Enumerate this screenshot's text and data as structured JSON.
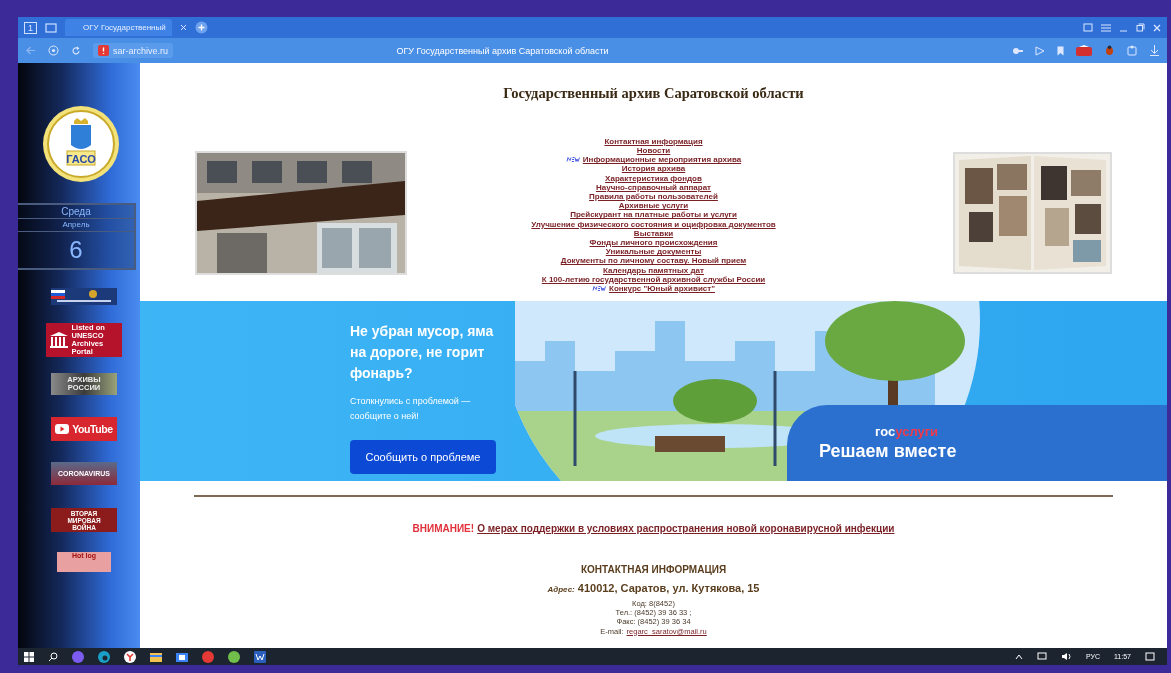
{
  "browser": {
    "tab_count": "1",
    "tabs": [
      {
        "label": "ОГУ Государственный",
        "selected": true
      }
    ],
    "address": "sar-archive.ru",
    "page_title": "ОГУ Государственный архив Саратовской области"
  },
  "sidebar": {
    "emblem_text": "ГАСО",
    "calendar": {
      "weekday": "Среда",
      "month": "Апрель",
      "day": "6"
    },
    "banners": [
      {
        "kind": "gosuslugi"
      },
      {
        "kind": "unesco",
        "text": "Listed on UNESCO Archives Portal"
      },
      {
        "kind": "archives",
        "text": "АРХИВЫ РОССИИ"
      },
      {
        "kind": "youtube",
        "text": "YouTube"
      },
      {
        "kind": "corona",
        "text": "CORONAVIRUS"
      },
      {
        "kind": "war",
        "text": "ВТОРАЯ МИРОВАЯ ВОЙНА"
      },
      {
        "kind": "hotlog",
        "text": "Hot log"
      }
    ]
  },
  "page": {
    "title": "Государственный архив Саратовской области",
    "menu": [
      {
        "text": "Контактная информация"
      },
      {
        "text": "Новости"
      },
      {
        "text": "Информационные мероприятия архива",
        "new": true
      },
      {
        "text": "История архива"
      },
      {
        "text": "Характеристика фондов"
      },
      {
        "text": "Научно-справочный аппарат"
      },
      {
        "text": "Правила работы пользователей"
      },
      {
        "text": "Архивные услуги"
      },
      {
        "text": "Прейскурант на платные работы и услуги"
      },
      {
        "text": "Улучшение физического состояния и оцифровка документов"
      },
      {
        "text": "Выставки"
      },
      {
        "text": "Фонды личного происхождения"
      },
      {
        "text": "Уникальные документы"
      },
      {
        "text": "Документы по личному составу. Новый прием"
      },
      {
        "text": "Календарь памятных дат"
      },
      {
        "text": "К 100-летию государственной архивной службы России"
      },
      {
        "text": "Конкурс \"Юный архивист\"",
        "new": true
      }
    ],
    "promo": {
      "headline": "Не убран мусор, яма на дороге, не горит фонарь?",
      "subtext": "Столкнулись с проблемой — сообщите о ней!",
      "button": "Сообщить о проблеме",
      "logo": [
        "гос",
        "услуги"
      ],
      "slogan": "Решаем вместе"
    },
    "notice": {
      "label": "ВНИМАНИЕ!",
      "link": "О мерах поддержки в условиях распространения новой коронавирусной инфекции"
    },
    "contacts": {
      "heading": "КОНТАКТНАЯ ИНФОРМАЦИЯ",
      "address_label": "Адрес:",
      "address": "410012, Саратов, ул. Кутякова, 15",
      "lines": [
        "Код: 8(8452)",
        "Тел.: (8452) 39 36 33 ;",
        "Факс: (8452) 39 36 34"
      ],
      "email_label": "E-mail:",
      "email": "regarc_saratov@mail.ru"
    }
  },
  "taskbar": {
    "language": "РУС",
    "time": "11:57"
  }
}
